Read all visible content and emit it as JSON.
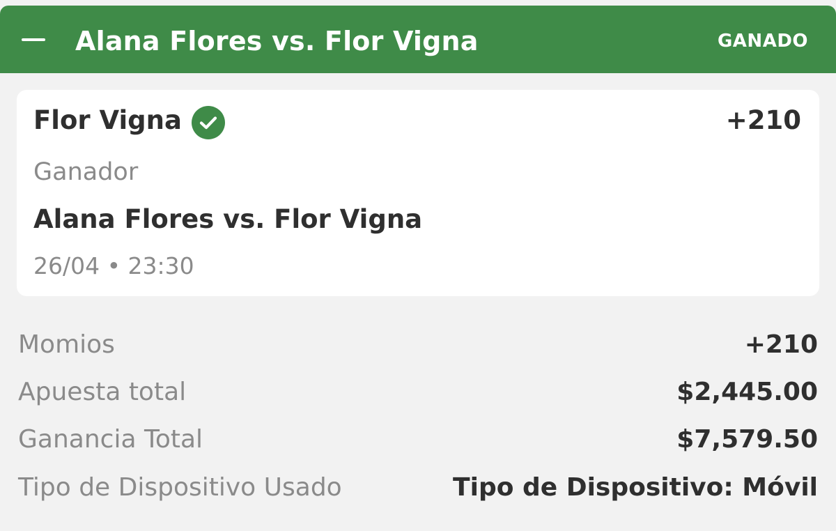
{
  "header": {
    "title": "Alana Flores vs. Flor Vigna",
    "status": "GANADO",
    "accent_color": "#3f8b48"
  },
  "selection": {
    "name": "Flor Vigna",
    "odds": "+210",
    "market": "Ganador",
    "event": "Alana Flores vs. Flor Vigna",
    "datetime": "26/04 • 23:30",
    "status_icon": "check-circle-icon"
  },
  "details": [
    {
      "label": "Momios",
      "value": "+210"
    },
    {
      "label": "Apuesta total",
      "value": "$2,445.00"
    },
    {
      "label": "Ganancia Total",
      "value": "$7,579.50"
    },
    {
      "label": "Tipo de Dispositivo Usado",
      "value": "Tipo de Dispositivo: Móvil"
    }
  ]
}
